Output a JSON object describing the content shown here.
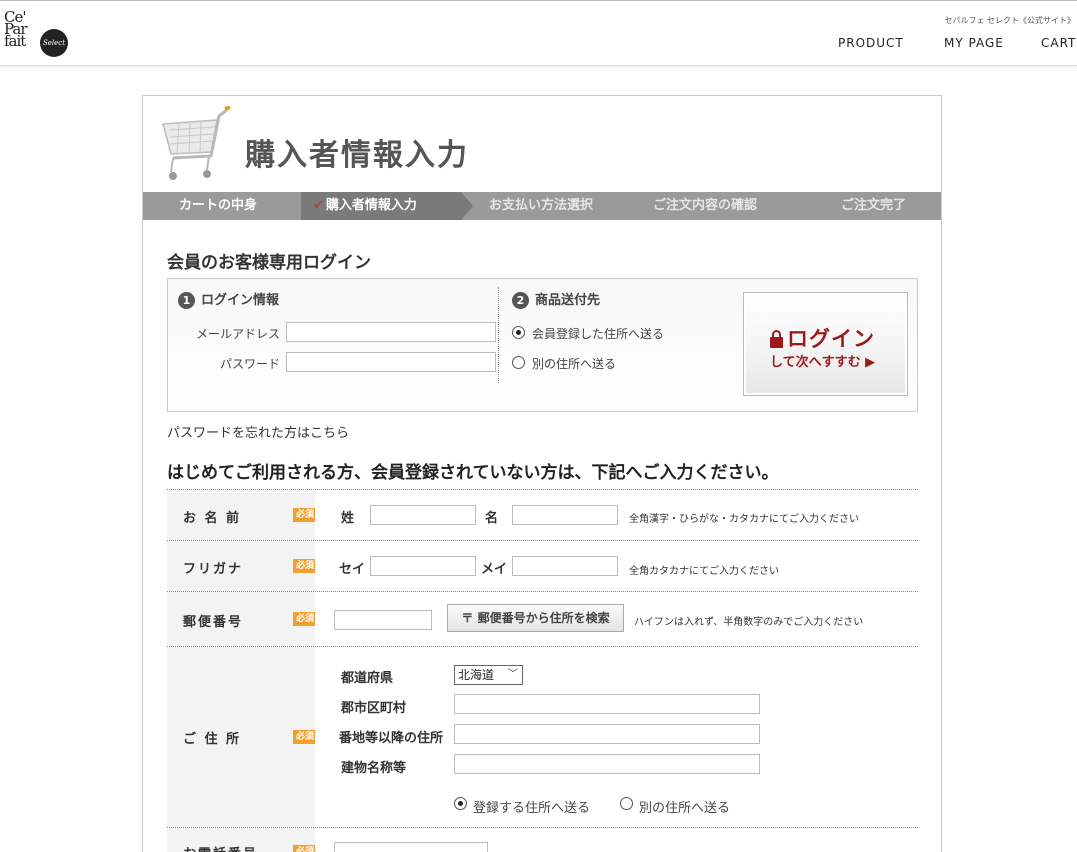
{
  "header": {
    "logo_text": "Ce' Par fait",
    "logo_sub": "Select",
    "tagline": "セパルフェ セレクト《公式サイト》",
    "nav": [
      "PRODUCT",
      "MY PAGE",
      "CART"
    ]
  },
  "page": {
    "title": "購入者情報入力"
  },
  "steps": [
    {
      "label": "カートの中身",
      "state": "done"
    },
    {
      "label": "購入者情報入力",
      "state": "current"
    },
    {
      "label": "お支払い方法選択",
      "state": "pending"
    },
    {
      "label": "ご注文内容の確認",
      "state": "pending"
    },
    {
      "label": "ご注文完了",
      "state": "pending"
    }
  ],
  "step_check": "✔",
  "login": {
    "heading": "会員のお客様専用ログイン",
    "info_number": "1",
    "info_title": "ログイン情報",
    "email_label": "メールアドレス",
    "email_value": "",
    "password_label": "パスワード",
    "password_value": "",
    "ship_number": "2",
    "ship_title": "商品送付先",
    "ship_option_registered": "会員登録した住所へ送る",
    "ship_option_other": "別の住所へ送る",
    "button_main": "ログイン",
    "button_sub": "して次へすすむ ▶",
    "forgot_link": "パスワードを忘れた方はこちら"
  },
  "form": {
    "heading": "はじめてご利用される方、会員登録されていない方は、下記へご入力ください。",
    "required_badge": "必須",
    "name": {
      "label": "お 名 前",
      "last_label": "姓",
      "first_label": "名",
      "note": "全角漢字・ひらがな・カタカナにてご入力ください"
    },
    "furigana": {
      "label": "フリガナ",
      "last_label": "セイ",
      "first_label": "メイ",
      "note": "全角カタカナにてご入力ください"
    },
    "zip": {
      "label": "郵便番号",
      "search_button": "〒 郵便番号から住所を検索",
      "note": "ハイフンは入れず、半角数字のみでご入力ください"
    },
    "address": {
      "label": "ご 住 所",
      "prefecture_label": "都道府県",
      "prefecture_value": "北海道",
      "city_label": "郡市区町村",
      "street_label": "番地等以降の住所",
      "building_label": "建物名称等",
      "ship_registered": "登録する住所へ送る",
      "ship_other": "別の住所へ送る"
    },
    "phone": {
      "label": "お電話番号"
    }
  }
}
